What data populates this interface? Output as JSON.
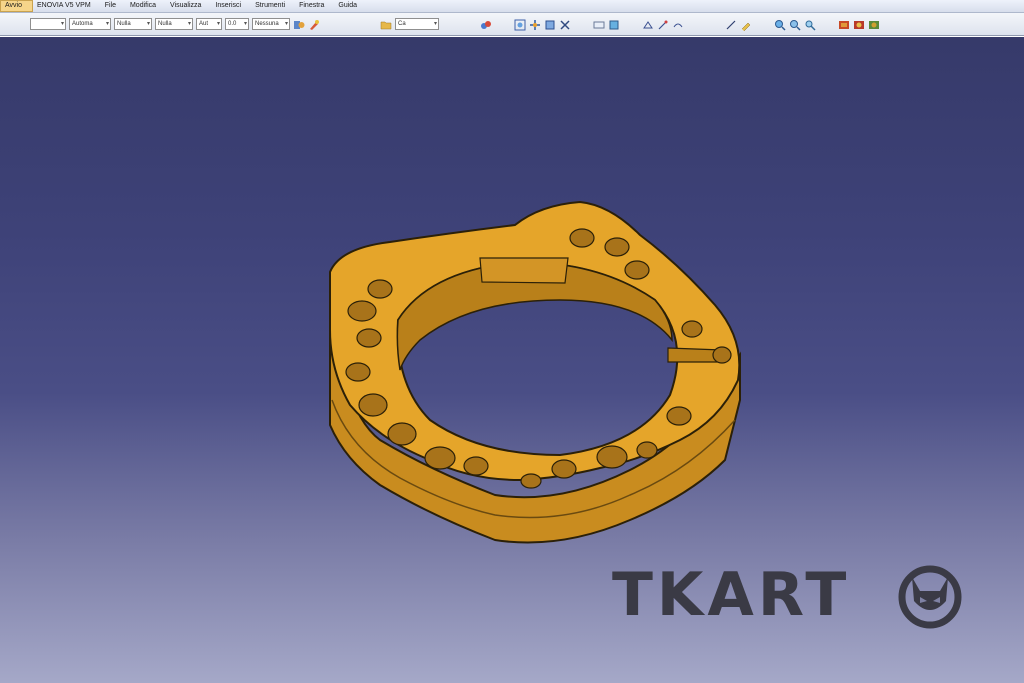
{
  "menu": {
    "items": [
      {
        "label": "Avvio",
        "active": true
      },
      {
        "label": "ENOVIA V5 VPM",
        "active": false
      },
      {
        "label": "File",
        "active": false
      },
      {
        "label": "Modifica",
        "active": false
      },
      {
        "label": "Visualizza",
        "active": false
      },
      {
        "label": "Inserisci",
        "active": false
      },
      {
        "label": "Strumenti",
        "active": false
      },
      {
        "label": "Finestra",
        "active": false
      },
      {
        "label": "Guida",
        "active": false
      }
    ]
  },
  "toolbar": {
    "selects": [
      "",
      "Automa",
      "Nulla",
      "Nulla",
      "Aut",
      "0.0",
      "Nessuna"
    ],
    "name_field": "Ca",
    "icons": {
      "properties": "properties-icon",
      "brush": "brush-icon",
      "folder": "folder-icon",
      "fly": "fly-mode-icon",
      "zoom": "zoom-icon",
      "pan": "pan-icon",
      "rotate": "rotate-icon",
      "fit": "fit-all-icon",
      "normal_view": "normal-view-icon",
      "render": "render-style-icon"
    }
  },
  "colors": {
    "part": "#e5a52a",
    "part_dark": "#b9801a",
    "part_light": "#f0bd4a",
    "hole": "#a8731a",
    "logo": "#3a3a45"
  },
  "logo": {
    "text": "TKART",
    "emblem": "cat-head-icon"
  }
}
